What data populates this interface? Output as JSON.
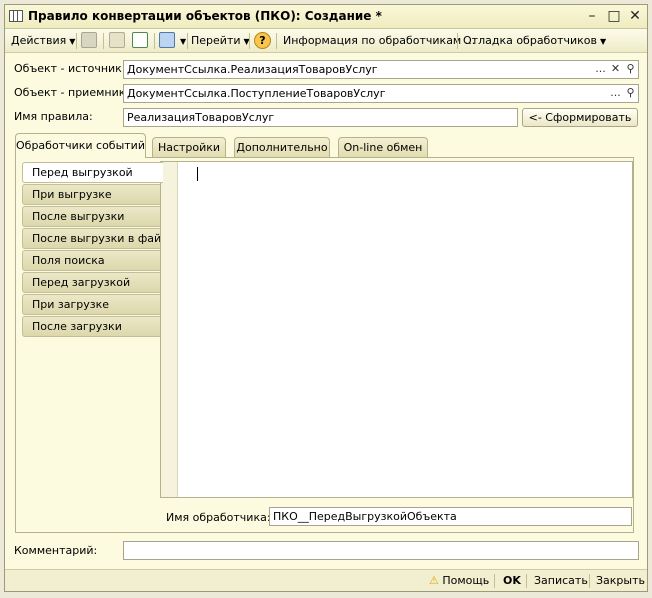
{
  "window": {
    "title": "Правило конвертации объектов (ПКО): Создание *"
  },
  "toolbar": {
    "actions": "Действия",
    "goto": "Перейти",
    "handlers_info": "Информация по обработчикам ...",
    "debug": "Отладка обработчиков",
    "help_glyph": "?"
  },
  "form": {
    "source_label": "Объект - источник:",
    "source_value": "ДокументСсылка.РеализацияТоваровУслуг",
    "target_label": "Объект - приемник:",
    "target_value": "ДокументСсылка.ПоступлениеТоваровУслуг",
    "rule_name_label": "Имя правила:",
    "rule_name_value": "РеализацияТоваровУслуг",
    "generate_button": "<- Сформировать",
    "comment_label": "Комментарий:",
    "comment_value": ""
  },
  "tabs": [
    {
      "label": "Обработчики событий"
    },
    {
      "label": "Настройки"
    },
    {
      "label": "Дополнительно"
    },
    {
      "label": "On-line обмен"
    }
  ],
  "handlers": [
    {
      "label": "Перед выгрузкой"
    },
    {
      "label": "При выгрузке"
    },
    {
      "label": "После выгрузки"
    },
    {
      "label": "После выгрузки в файл"
    },
    {
      "label": "Поля поиска"
    },
    {
      "label": "Перед загрузкой"
    },
    {
      "label": "При загрузке"
    },
    {
      "label": "После загрузки"
    }
  ],
  "handler_name": {
    "label": "Имя обработчика:",
    "value": "ПКО__ПередВыгрузкойОбъекта"
  },
  "footer": {
    "help": "Помощь",
    "ok": "OK",
    "save": "Записать",
    "close": "Закрыть"
  },
  "colors": {
    "window_bg": "#fcfbe0",
    "accent": "#e7a400"
  }
}
